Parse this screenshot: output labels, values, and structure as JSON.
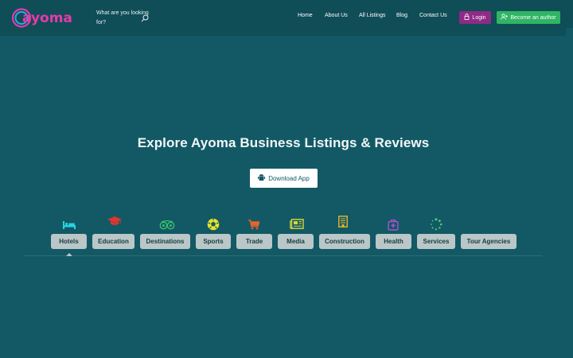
{
  "brand": {
    "logo_text": "ayoma"
  },
  "search": {
    "placeholder": "What are you looking for?"
  },
  "nav": {
    "items": [
      {
        "label": "Home"
      },
      {
        "label": "About Us"
      },
      {
        "label": "All Listings"
      },
      {
        "label": "Blog"
      },
      {
        "label": "Contact Us"
      }
    ],
    "login_label": "Login",
    "author_label": "Become an author"
  },
  "hero": {
    "title": "Explore Ayoma Business Listings & Reviews",
    "download_label": "Download App"
  },
  "categories": [
    {
      "label": "Hotels",
      "icon": "bed-icon",
      "color": "#26d3e0"
    },
    {
      "label": "Education",
      "icon": "graduation-cap-icon",
      "color": "#e0362b"
    },
    {
      "label": "Destinations",
      "icon": "tripadvisor-icon",
      "color": "#38c16b"
    },
    {
      "label": "Sports",
      "icon": "soccer-ball-icon",
      "color": "#e7e12a"
    },
    {
      "label": "Trade",
      "icon": "cart-icon",
      "color": "#e8642a"
    },
    {
      "label": "Media",
      "icon": "newspaper-icon",
      "color": "#d9d63a"
    },
    {
      "label": "Construction",
      "icon": "building-icon",
      "color": "#e9b62b"
    },
    {
      "label": "Health",
      "icon": "medical-bag-icon",
      "color": "#b04fd1"
    },
    {
      "label": "Services",
      "icon": "spinner-icon",
      "color": "#48d27a"
    },
    {
      "label": "Tour Agencies",
      "icon": "",
      "color": ""
    }
  ],
  "colors": {
    "background": "#125965",
    "header": "#0f4d57",
    "login_button": "#8f2a86",
    "author_button": "#2fb564",
    "category_button": "#b9c7c8"
  }
}
